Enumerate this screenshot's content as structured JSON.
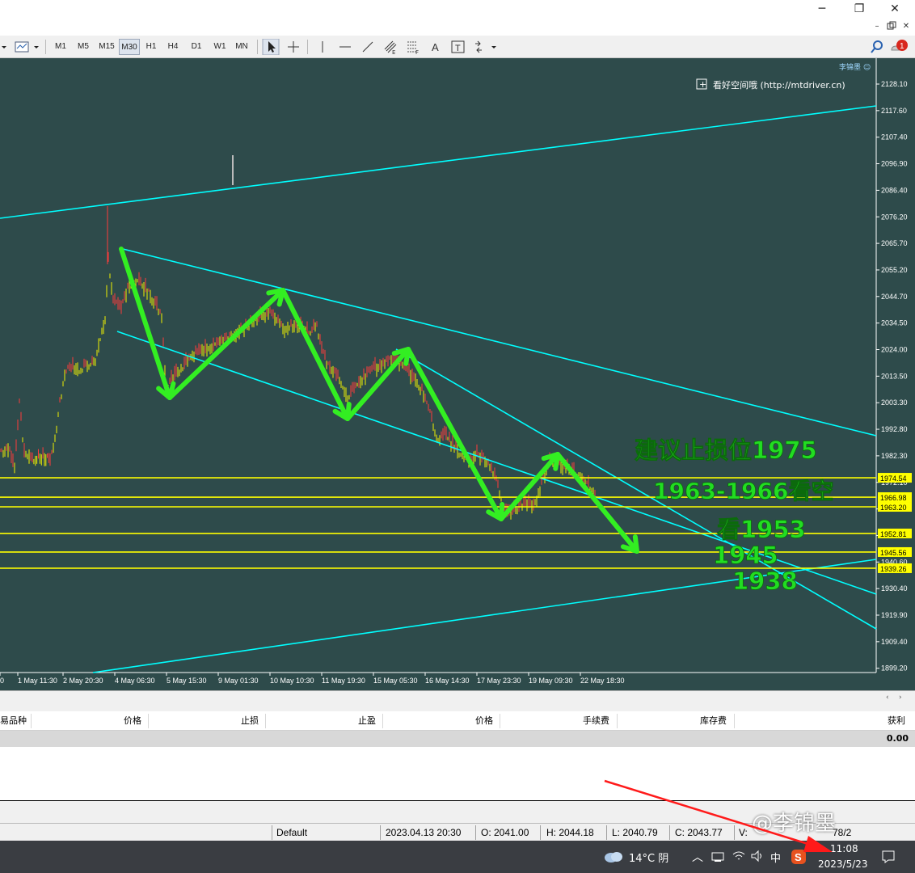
{
  "window": {
    "minimize": "─",
    "restore": "❐",
    "close": "✕"
  },
  "mdi": {
    "minimize": "–",
    "restore": "🗗",
    "close": "✕"
  },
  "toolbar": {
    "timeframes": [
      "M1",
      "M5",
      "M15",
      "M30",
      "H1",
      "H4",
      "D1",
      "W1",
      "MN"
    ],
    "active_timeframe": "M30",
    "text_tool": "A",
    "label_tool": "T",
    "notification_count": "1"
  },
  "chart": {
    "corner_label": "李锦墨 ☺",
    "indicator_toggle": "+",
    "indicator_label": "看好空间哦 (http://mtdriver.cn)",
    "price_ticks": [
      "2128.10",
      "2117.60",
      "2107.40",
      "2096.90",
      "2086.40",
      "2076.20",
      "2065.70",
      "2055.20",
      "2044.70",
      "2034.50",
      "2024.00",
      "2013.50",
      "2003.30",
      "1992.80",
      "1982.30",
      "1972.10",
      "1961.60",
      "1951.10",
      "1940.60",
      "1930.40",
      "1919.90",
      "1909.40",
      "1899.20"
    ],
    "price_levels": [
      {
        "label": "1974.54",
        "color": "#ffff00"
      },
      {
        "label": "1966.98",
        "color": "#ffff00"
      },
      {
        "label": "1963.20",
        "color": "#ffff00"
      },
      {
        "label": "1952.81",
        "color": "#ffff00"
      },
      {
        "label": "1945.56",
        "color": "#ffff00"
      },
      {
        "label": "1939.26",
        "color": "#ffff00"
      }
    ],
    "time_ticks": [
      "0",
      "1 May 11:30",
      "2 May 20:30",
      "4 May 06:30",
      "5 May 15:30",
      "9 May 01:30",
      "10 May 10:30",
      "11 May 19:30",
      "15 May 05:30",
      "16 May 14:30",
      "17 May 23:30",
      "19 May 09:30",
      "22 May 18:30"
    ],
    "annotations": {
      "stop_loss": "建议止损位1975",
      "short_zone": "1963-1966看空",
      "target1": "看1953",
      "target2": "1945",
      "target3": "1938"
    },
    "colors": {
      "background": "#2e4b4b",
      "channel": "#00ffff",
      "level": "#ffff00",
      "arrow": "#33ee22",
      "annotation": "#22dd22"
    }
  },
  "terminal": {
    "columns": [
      "易品种",
      "价格",
      "止损",
      "止盈",
      "价格",
      "手续费",
      "库存费",
      "获利"
    ],
    "total_profit": "0.00"
  },
  "status": {
    "profile": "Default",
    "datetime": "2023.04.13 20:30",
    "open": "O: 2041.00",
    "high": "H: 2044.18",
    "low": "L: 2040.79",
    "close": "C: 2043.77",
    "volume": "V:",
    "extra": "78/2"
  },
  "taskbar": {
    "weather": "14°C 阴",
    "ime": "中",
    "time": "11:08",
    "date": "2023/5/23"
  },
  "watermark": "@李锦墨"
}
